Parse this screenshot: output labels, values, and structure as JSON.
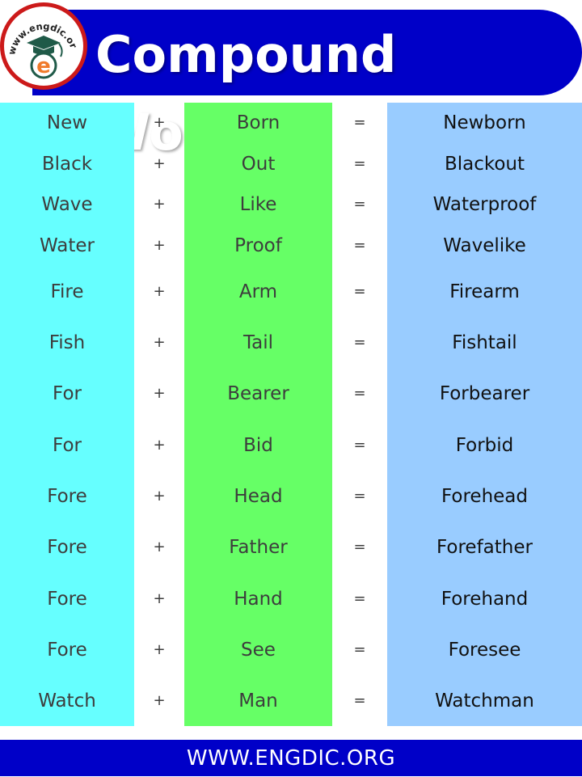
{
  "header": {
    "title": "Compound Words",
    "logo_text": "www.engdic.org",
    "logo_icon": "graduation-cap-e-logo-icon"
  },
  "colors": {
    "banner": "#0000c8",
    "column_first": "#66ffff",
    "column_second": "#66ff66",
    "column_result": "#99ccff",
    "logo_ring": "#cc1a1a",
    "logo_e": "#f07a2a",
    "logo_cap": "#1f5a48"
  },
  "rows": [
    {
      "first": "New",
      "op1": "+",
      "second": "Born",
      "op2": "=",
      "result": "Newborn"
    },
    {
      "first": "Black",
      "op1": "+",
      "second": "Out",
      "op2": "=",
      "result": "Blackout"
    },
    {
      "first": "Wave",
      "op1": "+",
      "second": "Like",
      "op2": "=",
      "result": "Waterproof"
    },
    {
      "first": "Water",
      "op1": "+",
      "second": "Proof",
      "op2": "=",
      "result": "Wavelike"
    },
    {
      "first": "Fire",
      "op1": "+",
      "second": "Arm",
      "op2": "=",
      "result": "Firearm"
    },
    {
      "first": "Fish",
      "op1": "+",
      "second": "Tail",
      "op2": "=",
      "result": "Fishtail"
    },
    {
      "first": "For",
      "op1": "+",
      "second": "Bearer",
      "op2": "=",
      "result": "Forbearer"
    },
    {
      "first": "For",
      "op1": "+",
      "second": "Bid",
      "op2": "=",
      "result": "Forbid"
    },
    {
      "first": "Fore",
      "op1": "+",
      "second": "Head",
      "op2": "=",
      "result": "Forehead"
    },
    {
      "first": "Fore",
      "op1": "+",
      "second": "Father",
      "op2": "=",
      "result": "Forefather"
    },
    {
      "first": "Fore",
      "op1": "+",
      "second": "Hand",
      "op2": "=",
      "result": "Forehand"
    },
    {
      "first": "Fore",
      "op1": "+",
      "second": "See",
      "op2": "=",
      "result": "Foresee"
    },
    {
      "first": "Watch",
      "op1": "+",
      "second": "Man",
      "op2": "=",
      "result": "Watchman"
    }
  ],
  "footer": {
    "url_text": "WWW.ENGDIC.ORG"
  }
}
